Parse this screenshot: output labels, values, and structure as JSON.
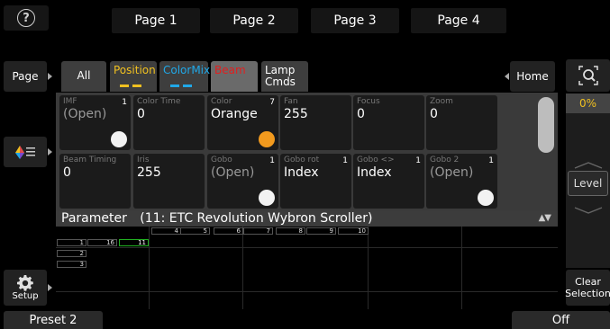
{
  "top": {
    "help_label": "?",
    "pages": [
      "Page 1",
      "Page 2",
      "Page 3",
      "Page 4"
    ]
  },
  "left": {
    "page_label": "Page",
    "color_icon": "color-palette-icon",
    "setup_label": "Setup",
    "setup_icon": "gear-icon"
  },
  "categories": {
    "all": "All",
    "position": "Position",
    "colormix": "ColorMix",
    "beam": "Beam",
    "lamp_line1": "Lamp",
    "lamp_line2": "Cmds",
    "home": "Home",
    "colors": {
      "position": "#f0c020",
      "colormix": "#20a8e8",
      "beam": "#e02020"
    }
  },
  "cells": [
    {
      "label": "IMF",
      "num": "1",
      "value": "(Open)",
      "dim": true,
      "dot": "#f2f2f2"
    },
    {
      "label": "Color Time",
      "num": "",
      "value": "0",
      "dim": false,
      "dot": ""
    },
    {
      "label": "Color",
      "num": "7",
      "value": "Orange",
      "dim": false,
      "dot": "#f29a1e"
    },
    {
      "label": "Fan",
      "num": "",
      "value": "255",
      "dim": false,
      "dot": ""
    },
    {
      "label": "Focus",
      "num": "",
      "value": "0",
      "dim": false,
      "dot": ""
    },
    {
      "label": "Zoom",
      "num": "",
      "value": "0",
      "dim": false,
      "dot": ""
    },
    {
      "label": "Beam Timing",
      "num": "",
      "value": "0",
      "dim": false,
      "dot": ""
    },
    {
      "label": "Iris",
      "num": "",
      "value": "255",
      "dim": false,
      "dot": ""
    },
    {
      "label": "Gobo",
      "num": "1",
      "value": "(Open)",
      "dim": true,
      "dot": "#f2f2f2"
    },
    {
      "label": "Gobo rot",
      "num": "1",
      "value": "Index",
      "dim": false,
      "dot": ""
    },
    {
      "label": "Gobo <>",
      "num": "1",
      "value": "Index",
      "dim": false,
      "dot": ""
    },
    {
      "label": "Gobo 2",
      "num": "1",
      "value": "(Open)",
      "dim": true,
      "dot": "#f2f2f2"
    }
  ],
  "parameter": {
    "label": "Parameter",
    "fixture": "(11: ETC Revolution Wybron Scroller)"
  },
  "grid": {
    "top_row": [
      "4",
      "5",
      "6",
      "7",
      "8",
      "9",
      "10"
    ],
    "row1": [
      "1",
      "16",
      "11"
    ],
    "row2": "2",
    "row3": "3",
    "selected_color": "#21b021"
  },
  "right": {
    "zoom_icon": "zoom-fit-icon",
    "fader_value": "0%",
    "fader_value_color": "#f0c020",
    "level_label": "Level",
    "clear_line1": "Clear",
    "clear_line2": "Selection"
  },
  "bottom": {
    "preset": "Preset 2",
    "off": "Off"
  }
}
